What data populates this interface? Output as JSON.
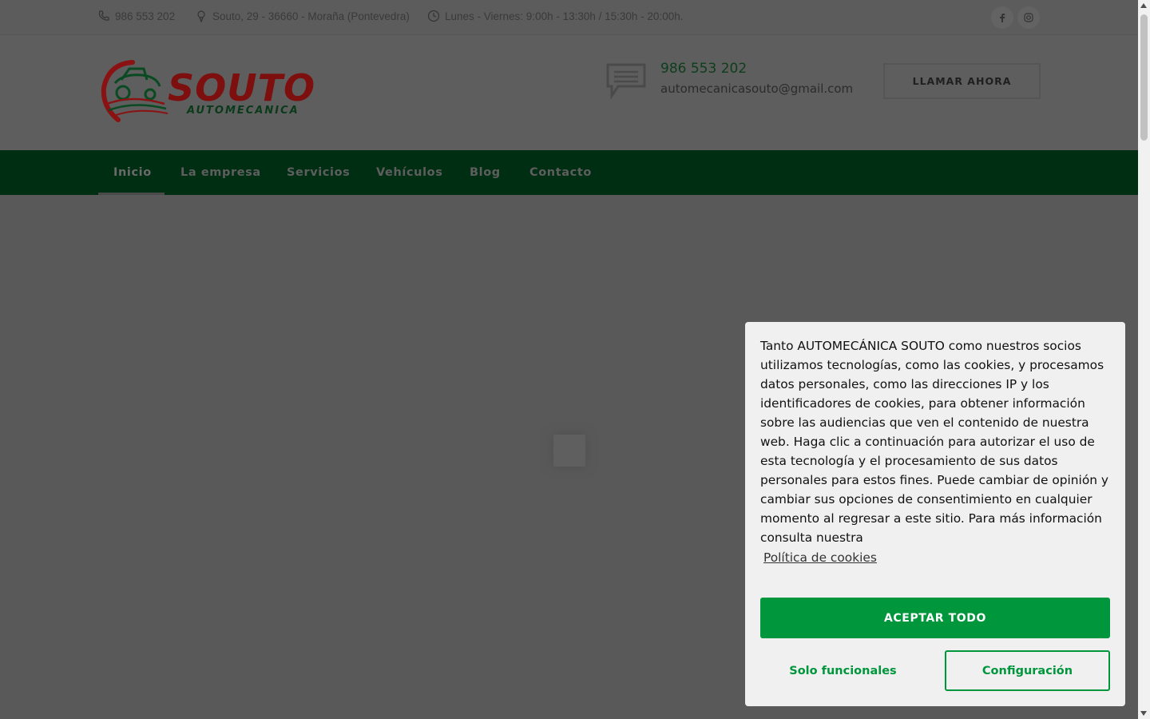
{
  "topbar": {
    "phone": "986 553 202",
    "address": "Souto, 29 - 36660 - Moraña (Pontevedra)",
    "hours": "Lunes - Viernes: 9:00h - 13:30h / 15:30h - 20:00h."
  },
  "header": {
    "logo_text": "SOUTO",
    "logo_subtext": "AUTOMECANICA",
    "phone": "986 553 202",
    "email": "automecanicasouto@gmail.com",
    "call_button": "LLAMAR AHORA"
  },
  "nav": {
    "items": [
      "Inicio",
      "La empresa",
      "Servicios",
      "Vehículos",
      "Blog",
      "Contacto"
    ],
    "active": "Inicio"
  },
  "cookie": {
    "message": "Tanto AUTOMECÁNICA SOUTO como nuestros socios utilizamos tecnologías, como las cookies, y procesamos datos personales, como las direcciones IP y los identificadores de cookies, para obtener información sobre las audiencias que ven el contenido de nuestra web. Haga clic a continuación para autorizar el uso de esta tecnología y el procesamiento de sus datos personales para estos fines. Puede cambiar de opinión y cambiar sus opciones de consentimiento en cualquier momento al regresar a este sitio. Para más información consulta nuestra",
    "policy_link": "Política de cookies",
    "accept_all": "ACEPTAR TODO",
    "functional_only": "Solo funcionales",
    "settings": "Configuración"
  },
  "colors": {
    "brand_green": "#00963c",
    "nav_bg": "#002e12",
    "logo_red": "#8a1212"
  }
}
